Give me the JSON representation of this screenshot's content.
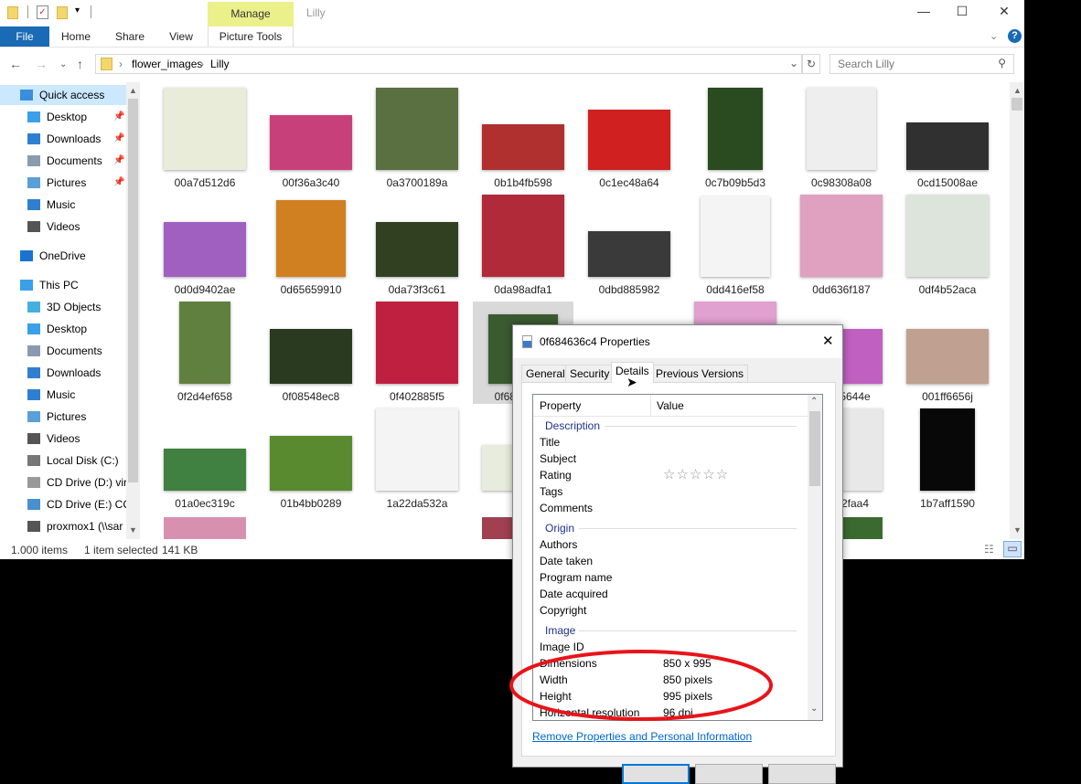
{
  "window": {
    "title": "Lilly",
    "manage_tab": "Manage",
    "ribbon_tabs": [
      "File",
      "Home",
      "Share",
      "View",
      "Picture Tools"
    ]
  },
  "address": {
    "path": [
      "flower_images",
      "Lilly"
    ],
    "search_placeholder": "Search Lilly"
  },
  "sidebar": {
    "items": [
      {
        "label": "Quick access",
        "icon": "star-icon",
        "color": "#3b8ede",
        "indent": 0,
        "pinned": false,
        "selected": true
      },
      {
        "label": "Desktop",
        "icon": "desktop-icon",
        "color": "#3aa0e8",
        "indent": 1,
        "pinned": true
      },
      {
        "label": "Downloads",
        "icon": "download-icon",
        "color": "#2f7fd0",
        "indent": 1,
        "pinned": true
      },
      {
        "label": "Documents",
        "icon": "documents-icon",
        "color": "#8a9bb0",
        "indent": 1,
        "pinned": true
      },
      {
        "label": "Pictures",
        "icon": "pictures-icon",
        "color": "#5aa0d8",
        "indent": 1,
        "pinned": true
      },
      {
        "label": "Music",
        "icon": "music-icon",
        "color": "#2f7fd0",
        "indent": 1,
        "pinned": false
      },
      {
        "label": "Videos",
        "icon": "videos-icon",
        "color": "#555",
        "indent": 1,
        "pinned": false
      },
      {
        "label": "OneDrive",
        "icon": "cloud-icon",
        "color": "#1a73d0",
        "indent": 0,
        "pinned": false,
        "gap": true
      },
      {
        "label": "This PC",
        "icon": "pc-icon",
        "color": "#3aa0e8",
        "indent": 0,
        "pinned": false,
        "gap": true
      },
      {
        "label": "3D Objects",
        "icon": "cube-icon",
        "color": "#45b0e0",
        "indent": 1
      },
      {
        "label": "Desktop",
        "icon": "desktop-icon",
        "color": "#3aa0e8",
        "indent": 1
      },
      {
        "label": "Documents",
        "icon": "documents-icon",
        "color": "#8a9bb0",
        "indent": 1
      },
      {
        "label": "Downloads",
        "icon": "download-icon",
        "color": "#2f7fd0",
        "indent": 1
      },
      {
        "label": "Music",
        "icon": "music-icon",
        "color": "#2f7fd0",
        "indent": 1
      },
      {
        "label": "Pictures",
        "icon": "pictures-icon",
        "color": "#5aa0d8",
        "indent": 1
      },
      {
        "label": "Videos",
        "icon": "videos-icon",
        "color": "#555",
        "indent": 1
      },
      {
        "label": "Local Disk (C:)",
        "icon": "disk-icon",
        "color": "#777",
        "indent": 1
      },
      {
        "label": "CD Drive (D:) virt",
        "icon": "cd-drive-icon",
        "color": "#999",
        "indent": 1
      },
      {
        "label": "CD Drive (E:) CC",
        "icon": "cd-drive-icon",
        "color": "#4a8fd0",
        "indent": 1
      },
      {
        "label": "proxmox1 (\\\\sar",
        "icon": "network-drive-icon",
        "color": "#555",
        "indent": 1
      }
    ]
  },
  "files": [
    {
      "name": "00a7d512d6",
      "color": "#e8ecd8",
      "w": 90,
      "h": 90
    },
    {
      "name": "00f36a3c40",
      "color": "#c8407a",
      "w": 90,
      "h": 60
    },
    {
      "name": "0a3700189a",
      "color": "#5a7040",
      "w": 90,
      "h": 90
    },
    {
      "name": "0b1b4fb598",
      "color": "#b03030",
      "w": 90,
      "h": 50
    },
    {
      "name": "0c1ec48a64",
      "color": "#d02020",
      "w": 90,
      "h": 66
    },
    {
      "name": "0c7b09b5d3",
      "color": "#2a4a20",
      "w": 60,
      "h": 90
    },
    {
      "name": "0c98308a08",
      "color": "#eeeeee",
      "w": 76,
      "h": 90
    },
    {
      "name": "0cd15008ae",
      "color": "#303030",
      "w": 90,
      "h": 52
    },
    {
      "name": "0d0d9402ae",
      "color": "#a060c0",
      "w": 90,
      "h": 60
    },
    {
      "name": "0d65659910",
      "color": "#d08020",
      "w": 76,
      "h": 84
    },
    {
      "name": "0da73f3c61",
      "color": "#304020",
      "w": 90,
      "h": 60
    },
    {
      "name": "0da98adfa1",
      "color": "#b02a3a",
      "w": 90,
      "h": 90
    },
    {
      "name": "0dbd885982",
      "color": "#3a3a3a",
      "w": 90,
      "h": 50
    },
    {
      "name": "0dd416ef58",
      "color": "#f4f4f4",
      "w": 76,
      "h": 88
    },
    {
      "name": "0dd636f187",
      "color": "#e0a0c0",
      "w": 90,
      "h": 90
    },
    {
      "name": "0df4b52aca",
      "color": "#dde4dc",
      "w": 90,
      "h": 90
    },
    {
      "name": "0f2d4ef658",
      "color": "#608040",
      "w": 56,
      "h": 90
    },
    {
      "name": "0f08548ec8",
      "color": "#2a3a20",
      "w": 90,
      "h": 60
    },
    {
      "name": "0f402885f5",
      "color": "#c02040",
      "w": 90,
      "h": 90
    },
    {
      "name": "0f684636c4",
      "color": "#3a5a30",
      "w": 76,
      "h": 76,
      "selected": true
    },
    {
      "name": "",
      "color": "#fff",
      "w": 0,
      "h": 0
    },
    {
      "name": "",
      "color": "#e0a0d0",
      "w": 90,
      "h": 90
    },
    {
      "name": "005f05644e",
      "color": "#c060c0",
      "w": 90,
      "h": 60
    },
    {
      "name": "001ff6656j",
      "color": "#c0a090",
      "w": 90,
      "h": 60
    },
    {
      "name": "01a0ec319c",
      "color": "#408040",
      "w": 90,
      "h": 46
    },
    {
      "name": "01b4bb0289",
      "color": "#5a8a30",
      "w": 90,
      "h": 60
    },
    {
      "name": "1a22da532a",
      "color": "#f4f4f4",
      "w": 90,
      "h": 90
    },
    {
      "name": "1a0",
      "color": "#e8ecdc",
      "w": 90,
      "h": 50
    },
    {
      "name": "",
      "color": "#fff",
      "w": 0,
      "h": 0
    },
    {
      "name": "",
      "color": "#fff",
      "w": 0,
      "h": 0
    },
    {
      "name": "1b2f32faa4",
      "color": "#e8e8e8",
      "w": 90,
      "h": 90
    },
    {
      "name": "1b7aff1590",
      "color": "#080808",
      "w": 60,
      "h": 90
    }
  ],
  "partial_row": [
    {
      "color": "#d890b0"
    },
    {
      "color": "#ffffff"
    },
    {
      "color": "#ffffff"
    },
    {
      "color": "#a04050"
    },
    {
      "color": "#ffffff"
    },
    {
      "color": "#ffffff"
    },
    {
      "color": "#3a6a30"
    },
    {
      "color": "#ffffff"
    }
  ],
  "status": {
    "count": "1.000 items",
    "selected": "1 item selected",
    "size": "141 KB"
  },
  "dialog": {
    "title": "0f684636c4 Properties",
    "tabs": [
      "General",
      "Security",
      "Details",
      "Previous Versions"
    ],
    "active_tab": "Details",
    "columns": [
      "Property",
      "Value"
    ],
    "groups": [
      {
        "name": "Description",
        "rows": [
          {
            "property": "Title",
            "value": ""
          },
          {
            "property": "Subject",
            "value": ""
          },
          {
            "property": "Rating",
            "value": "",
            "stars": 0
          },
          {
            "property": "Tags",
            "value": ""
          },
          {
            "property": "Comments",
            "value": ""
          }
        ]
      },
      {
        "name": "Origin",
        "rows": [
          {
            "property": "Authors",
            "value": ""
          },
          {
            "property": "Date taken",
            "value": ""
          },
          {
            "property": "Program name",
            "value": ""
          },
          {
            "property": "Date acquired",
            "value": ""
          },
          {
            "property": "Copyright",
            "value": ""
          }
        ]
      },
      {
        "name": "Image",
        "rows": [
          {
            "property": "Image ID",
            "value": ""
          },
          {
            "property": "Dimensions",
            "value": "850 x 995"
          },
          {
            "property": "Width",
            "value": "850 pixels"
          },
          {
            "property": "Height",
            "value": "995 pixels"
          },
          {
            "property": "Horizontal resolution",
            "value": "96 dpi"
          }
        ]
      }
    ],
    "rating_stars": "☆☆☆☆☆",
    "remove_link": "Remove Properties and Personal Information"
  },
  "annotation": {
    "color": "#e8141a",
    "shape": "ellipse"
  }
}
